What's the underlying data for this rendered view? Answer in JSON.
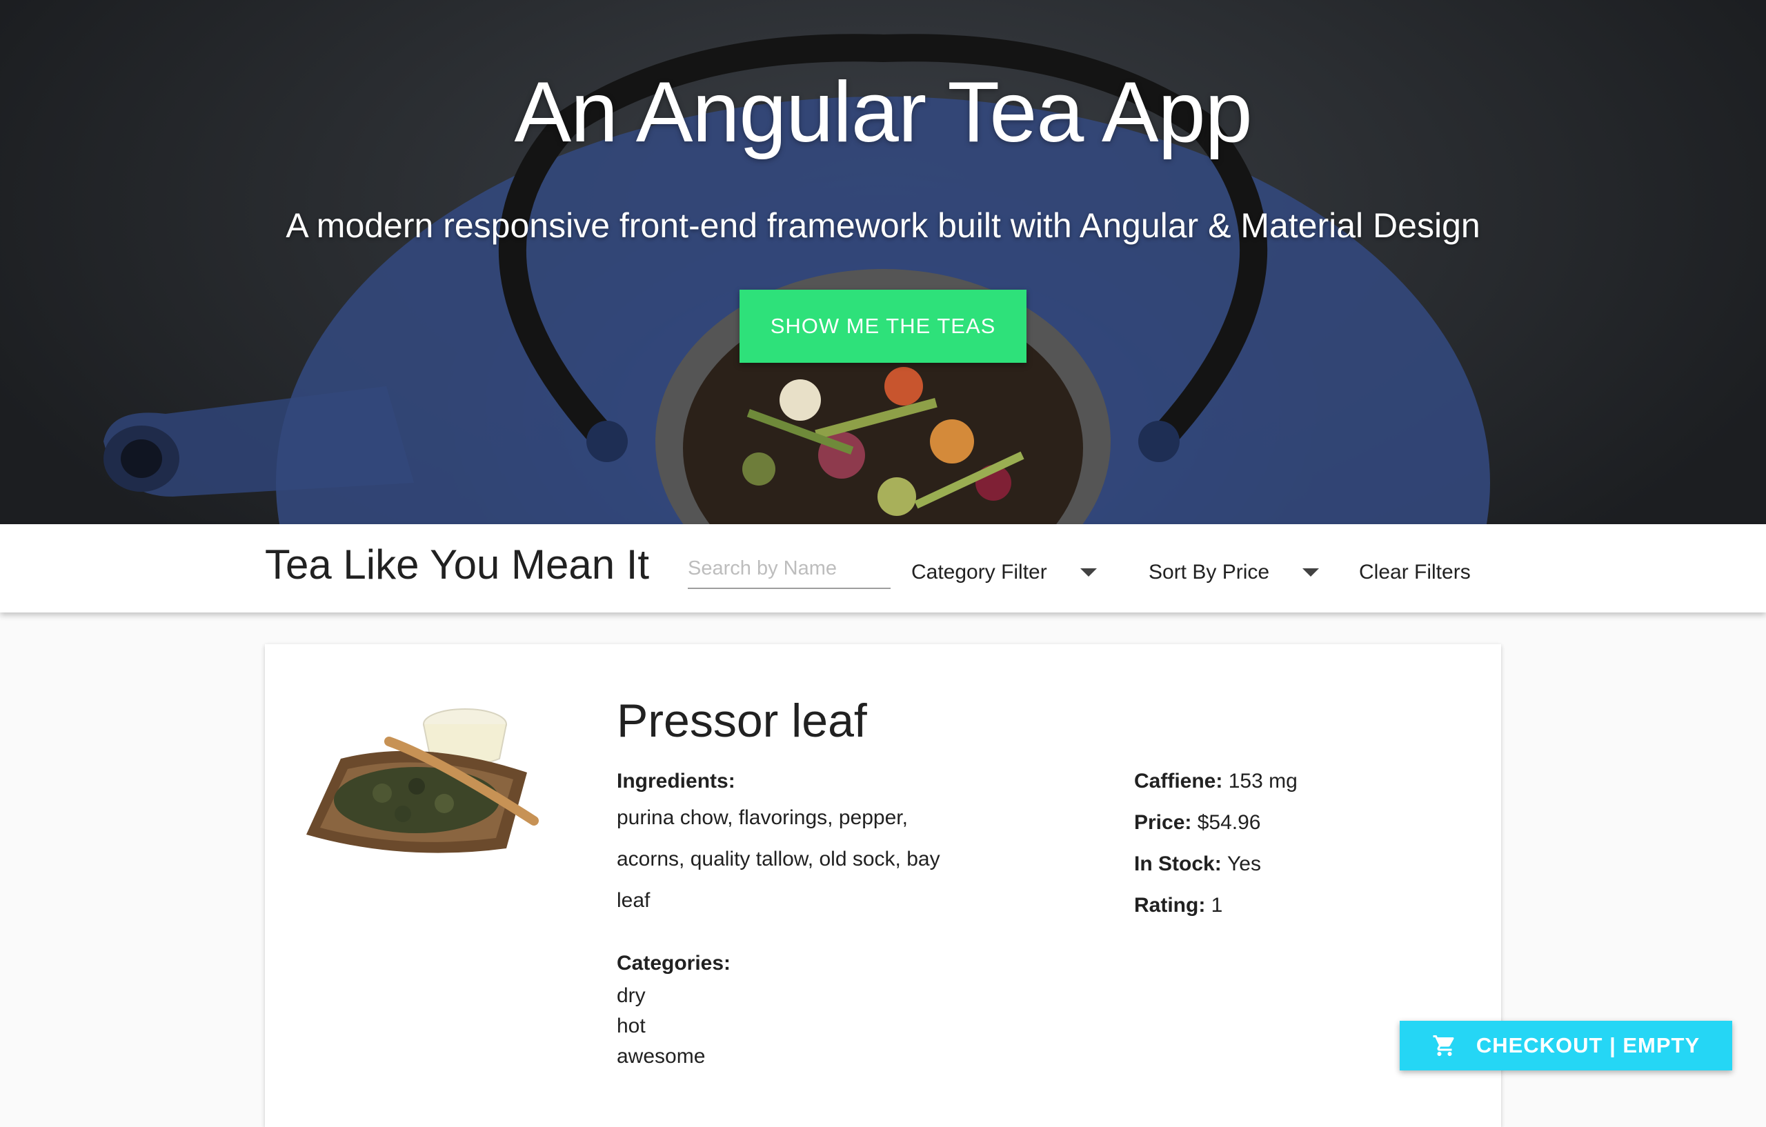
{
  "hero": {
    "title": "An Angular Tea App",
    "subtitle": "A modern responsive front-end framework built with Angular & Material Design",
    "cta_label": "SHOW ME THE TEAS"
  },
  "toolbar": {
    "brand": "Tea Like You Mean It",
    "search_placeholder": "Search by Name",
    "category_filter_label": "Category Filter",
    "sort_label": "Sort By Price",
    "clear_label": "Clear Filters"
  },
  "tea": {
    "name": "Pressor leaf",
    "ingredients_label": "Ingredients:",
    "ingredients": [
      "purina chow, flavorings, pepper,",
      "acorns, quality tallow, old sock, bay",
      "leaf"
    ],
    "categories_label": "Categories:",
    "categories": [
      "dry",
      "hot",
      "awesome"
    ],
    "caffeine_label": "Caffiene:",
    "caffeine": "153 mg",
    "price_label": "Price:",
    "price": "$54.96",
    "stock_label": "In Stock:",
    "stock": "Yes",
    "rating_label": "Rating:",
    "rating": "1"
  },
  "checkout": {
    "label": "CHECKOUT | EMPTY"
  },
  "colors": {
    "cta": "#2ee17a",
    "checkout": "#25d6f5"
  }
}
